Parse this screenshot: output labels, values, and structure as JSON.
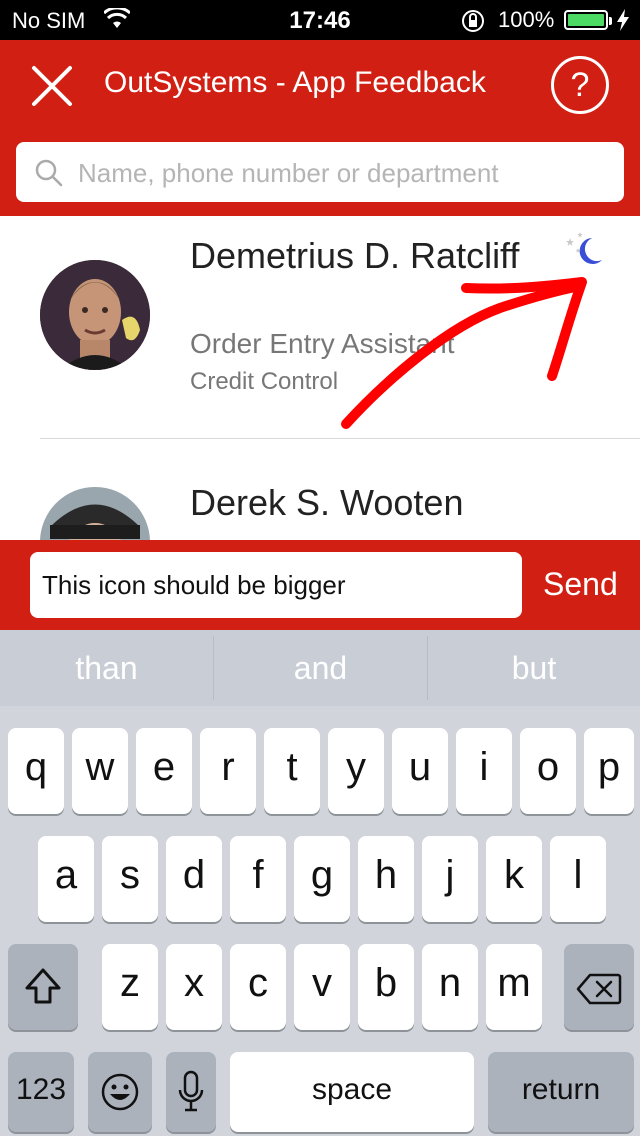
{
  "status_bar": {
    "carrier": "No SIM",
    "time": "17:46",
    "battery_percent": "100%",
    "battery_level": 1.0,
    "icons": [
      "wifi-icon",
      "orientation-lock-icon",
      "battery-icon",
      "charging-icon"
    ]
  },
  "header": {
    "title": "OutSystems - App Feedback",
    "close_icon": "close-icon",
    "help_label": "?",
    "color": "#d21f14"
  },
  "search": {
    "placeholder": "Name, phone number or department",
    "icon": "search-icon"
  },
  "contacts": [
    {
      "name": "Demetrius D. Ratcliff",
      "title": "Order Entry Assistant",
      "department": "Credit Control",
      "status_icon": "moon-stars-icon"
    },
    {
      "name": "Derek S. Wooten",
      "title": "",
      "department": ""
    }
  ],
  "annotation": {
    "icon": "arrow-annotation",
    "color": "#ff0000"
  },
  "feedback": {
    "input_value": "This icon should be bigger",
    "send_label": "Send"
  },
  "keyboard": {
    "suggestions": [
      "than",
      "and",
      "but"
    ],
    "row1": [
      "q",
      "w",
      "e",
      "r",
      "t",
      "y",
      "u",
      "i",
      "o",
      "p"
    ],
    "row2": [
      "a",
      "s",
      "d",
      "f",
      "g",
      "h",
      "j",
      "k",
      "l"
    ],
    "row3": [
      "z",
      "x",
      "c",
      "v",
      "b",
      "n",
      "m"
    ],
    "numbers_label": "123",
    "space_label": "space",
    "return_label": "return",
    "icons": [
      "shift-icon",
      "backspace-icon",
      "emoji-icon",
      "microphone-icon"
    ]
  }
}
